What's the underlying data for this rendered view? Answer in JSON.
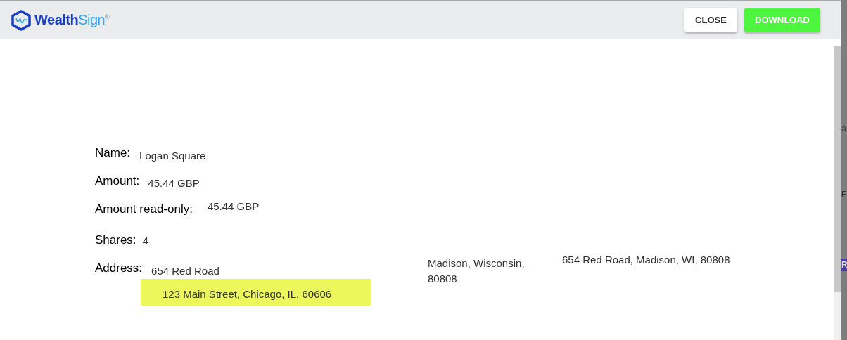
{
  "header": {
    "logo": {
      "bold": "Wealth",
      "light": "Sign",
      "mark": "®"
    },
    "buttons": [
      {
        "label": "CLOSE",
        "kind": "secondary"
      },
      {
        "label": "DOWNLOAD",
        "kind": "primary"
      }
    ]
  },
  "document": {
    "fields": [
      {
        "label": "Name:",
        "value": "Logan Square"
      },
      {
        "label": "Amount:",
        "value": "45.44 GBP"
      },
      {
        "label": "Amount read-only:",
        "value": "45.44 GBP"
      },
      {
        "label": "Shares:",
        "value": "4"
      }
    ],
    "address": {
      "label": "Address:",
      "line1": "654 Red Road",
      "highlighted": "123 Main Street, Chicago, IL, 60606",
      "city": "Madison, Wisconsin, 80808",
      "full": "654 Red Road, Madison, WI, 80808"
    }
  },
  "background_fragments": [
    "a",
    "F",
    "R"
  ]
}
